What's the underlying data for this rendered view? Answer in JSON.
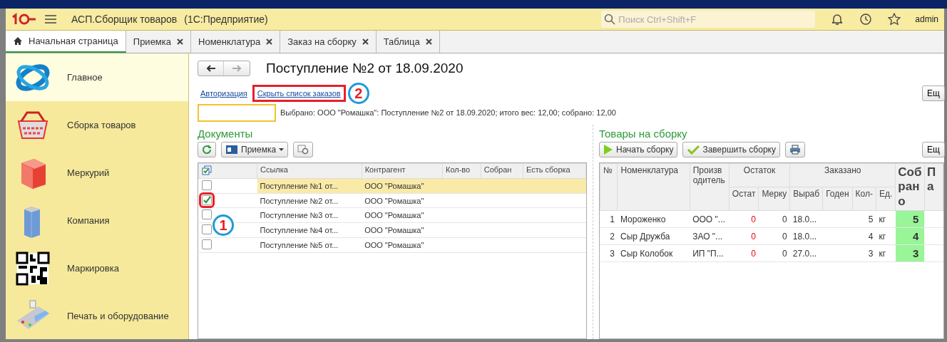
{
  "app_header": {
    "title": "АСП.Сборщик товаров",
    "platform": "(1С:Предприятие)",
    "search": {
      "placeholder": "Поиск Ctrl+Shift+F"
    },
    "user": "admin"
  },
  "tabs": [
    {
      "label": "Начальная страница",
      "selected": true,
      "kind": "home"
    },
    {
      "label": "Приемка",
      "selected": false,
      "kind": "closable"
    },
    {
      "label": "Номенклатура",
      "selected": false,
      "kind": "closable"
    },
    {
      "label": "Заказ на сборку",
      "selected": false,
      "kind": "closable"
    },
    {
      "label": "Таблица",
      "selected": false,
      "kind": "closable"
    }
  ],
  "sidebar": {
    "items": [
      {
        "label": "Главное",
        "selected": true,
        "kind": "main"
      },
      {
        "label": "Сборка товаров",
        "selected": false,
        "kind": "basket"
      },
      {
        "label": "Меркурий",
        "selected": false,
        "kind": "cube"
      },
      {
        "label": "Компания",
        "selected": false,
        "kind": "building"
      },
      {
        "label": "Маркировка",
        "selected": false,
        "kind": "qr"
      },
      {
        "label": "Печать и оборудование",
        "selected": false,
        "kind": "terminal"
      }
    ]
  },
  "document": {
    "title": "Поступление №2 от 18.09.2020",
    "links": [
      {
        "label": "Авторизация",
        "highlighted": false
      },
      {
        "label": "Скрыть список заказов",
        "highlighted": true,
        "annotation": "2"
      }
    ],
    "more_button": "Ещ",
    "summary": "Выбрано: ООО \"Ромашка\": Поступление №2 от 18.09.2020; итого вес: 12,00; собрано: 12,00"
  },
  "documents": {
    "title": "Документы",
    "toolbar": {
      "dropdown": "Приемка"
    },
    "columns": [
      "Ссылка",
      "Контрагент",
      "Кол-во",
      "Собран",
      "Есть сборка"
    ],
    "annotation": "1",
    "rows": [
      {
        "checked": false,
        "selected": true,
        "highlighted": false,
        "ref": "Поступление №1 от...",
        "partner": "ООО \"Ромашка\""
      },
      {
        "checked": true,
        "selected": false,
        "highlighted": true,
        "ref": "Поступление №2 от...",
        "partner": "ООО \"Ромашка\""
      },
      {
        "checked": false,
        "selected": false,
        "highlighted": false,
        "ref": "Поступление №3 от...",
        "partner": "ООО \"Ромашка\""
      },
      {
        "checked": false,
        "selected": false,
        "highlighted": false,
        "ref": "Поступление №4 от...",
        "partner": "ООО \"Ромашка\""
      },
      {
        "checked": false,
        "selected": false,
        "highlighted": false,
        "ref": "Поступление №5 от...",
        "partner": "ООО \"Ромашка\""
      }
    ]
  },
  "goods": {
    "title": "Товары на сборку",
    "buttons": [
      "Начать сборку",
      "Завершить сборку"
    ],
    "more_button": "Ещ",
    "columns": {
      "number": "№",
      "name": "Номенклатура",
      "maker": "Производитель",
      "stock": "Остаток",
      "stock_sub": [
        "Остат",
        "Мерку"
      ],
      "ordered": "Заказано",
      "ordered_sub": [
        "Выраб",
        "Годен",
        "Кол-",
        "Ед."
      ],
      "collected": "Собрано",
      "column_12": "Па"
    },
    "rows": [
      {
        "number": "1",
        "name": "Мороженко",
        "maker": "ООО \"...",
        "stock": "0",
        "merku": "0",
        "made": "18.0...",
        "qty": "5",
        "unit": "кг",
        "collected": "5"
      },
      {
        "number": "2",
        "name": "Сыр Дружба",
        "maker": "ЗАО \"...",
        "stock": "0",
        "merku": "0",
        "made": "18.0...",
        "qty": "4",
        "unit": "кг",
        "collected": "4"
      },
      {
        "number": "3",
        "name": "Сыр Колобок",
        "maker": "ИП \"П...",
        "stock": "0",
        "merku": "0",
        "made": "27.0...",
        "qty": "3",
        "unit": "кг",
        "collected": "3"
      }
    ]
  }
}
